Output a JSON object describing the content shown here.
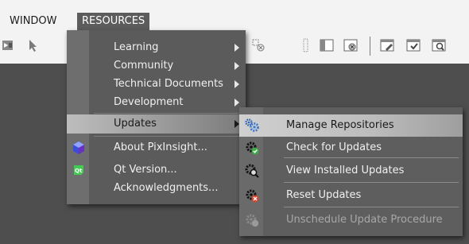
{
  "menubar": {
    "window": "WINDOW",
    "resources": "RESOURCES"
  },
  "toolbar": {
    "icons": [
      "arrange-icon",
      "pointer-icon",
      "layout-icon",
      "layout-icon",
      "layout-icon",
      "close-layout-icon",
      "grid-icon",
      "window-icon",
      "window-close-icon",
      "image-edit-icon",
      "image-check-icon",
      "image-search-icon"
    ]
  },
  "resources_menu": {
    "items": [
      {
        "label": "Learning",
        "submenu": true
      },
      {
        "label": "Community",
        "submenu": true
      },
      {
        "label": "Technical Documents",
        "submenu": true
      },
      {
        "label": "Development",
        "submenu": true
      },
      {
        "label": "Updates",
        "submenu": true,
        "highlighted": true
      },
      {
        "label": "About PixInsight...",
        "icon": "pixinsight-logo-icon"
      },
      {
        "label": "Qt Version...",
        "icon": "qt-logo-icon",
        "icon_text": "Qt"
      },
      {
        "label": "Acknowledgments..."
      }
    ]
  },
  "updates_submenu": {
    "items": [
      {
        "label": "Manage Repositories",
        "icon": "gear-blue-icon",
        "highlighted": true
      },
      {
        "label": "Check for Updates",
        "icon": "gear-check-icon"
      },
      {
        "label": "View Installed Updates",
        "icon": "gear-search-icon"
      },
      {
        "label": "Reset Updates",
        "icon": "gear-reset-icon"
      },
      {
        "label": "Unschedule Update Procedure",
        "icon": "gear-unschedule-icon",
        "disabled": true
      }
    ]
  },
  "colors": {
    "menu_bg": "#5b5b5b",
    "highlight": "#bdbdbd",
    "workspace": "#4e4e4e",
    "check_green": "#3fae49",
    "reset_red": "#d9452c",
    "pixinsight_blue": "#3a4fd8",
    "qt_green": "#41cd52"
  }
}
